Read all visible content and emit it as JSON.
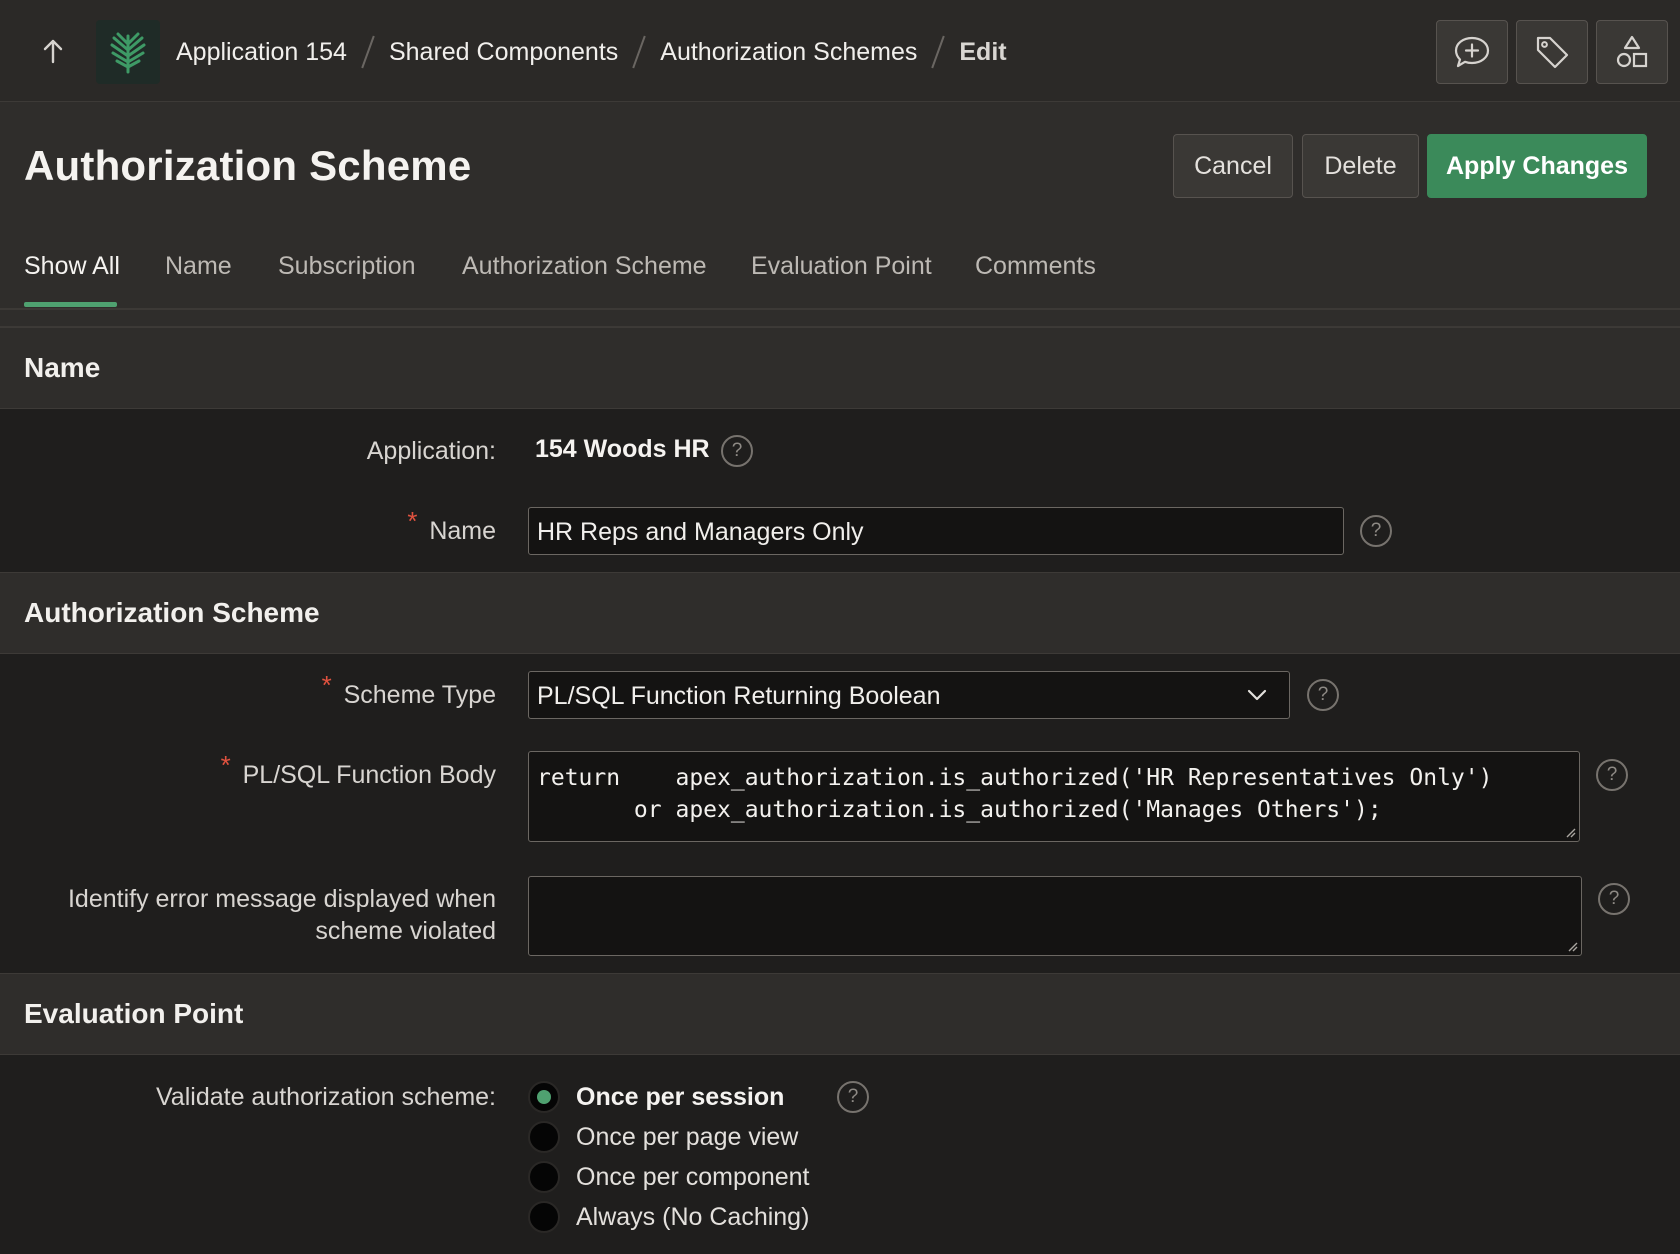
{
  "breadcrumb": {
    "items": [
      "Application 154",
      "Shared Components",
      "Authorization Schemes"
    ],
    "current": "Edit"
  },
  "icons": {
    "back": "arrow-up-icon",
    "logo": "tree-logo-icon",
    "feedback": "chat-plus-icon",
    "tag": "tag-icon",
    "shapes": "shapes-icon",
    "help": "question-circle-icon",
    "dropdown": "chevron-down-icon"
  },
  "header": {
    "title": "Authorization Scheme",
    "cancel": "Cancel",
    "delete": "Delete",
    "apply": "Apply Changes"
  },
  "tabs": [
    "Show All",
    "Name",
    "Subscription",
    "Authorization Scheme",
    "Evaluation Point",
    "Comments"
  ],
  "regions": {
    "name": {
      "title": "Name",
      "application_label": "Application:",
      "application_value": "154 Woods HR",
      "name_label": "Name",
      "name_value": "HR Reps and Managers Only"
    },
    "auth": {
      "title": "Authorization Scheme",
      "scheme_type_label": "Scheme Type",
      "scheme_type_value": "PL/SQL Function Returning Boolean",
      "function_body_label": "PL/SQL Function Body",
      "function_body_value": "return    apex_authorization.is_authorized('HR Representatives Only')\n       or apex_authorization.is_authorized('Manages Others');",
      "error_label_line1": "Identify error message displayed when",
      "error_label_line2": "scheme violated",
      "error_value": ""
    },
    "eval": {
      "title": "Evaluation Point",
      "validate_label": "Validate authorization scheme:",
      "options": [
        "Once per session",
        "Once per page view",
        "Once per component",
        "Always (No Caching)"
      ],
      "selected": "Once per session"
    }
  },
  "colors": {
    "accent": "#3b8a5a",
    "required": "#e0523f",
    "background": "#2f2d2b",
    "panel": "#1f1e1d"
  }
}
